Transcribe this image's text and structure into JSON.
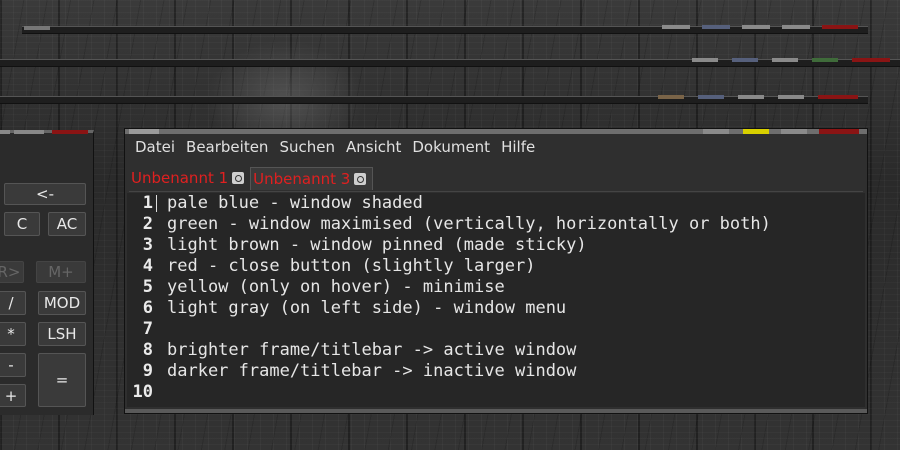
{
  "colors": {
    "pale_blue": "#56607c",
    "green": "#3f6b3a",
    "light_brown": "#7a6448",
    "red": "#8a1414",
    "yellow": "#d8d000",
    "light_gray": "#8a8a8a",
    "tab_text": "#e02020"
  },
  "calculator": {
    "buttons": [
      "<-",
      "C",
      "AC",
      "/",
      "MOD",
      "*",
      "LSH",
      "-",
      "=",
      "+"
    ],
    "dim_buttons": [
      "R>",
      "M+"
    ]
  },
  "editor": {
    "menu": [
      "Datei",
      "Bearbeiten",
      "Suchen",
      "Ansicht",
      "Dokument",
      "Hilfe"
    ],
    "tabs": [
      {
        "label": "Unbenannt 1",
        "icon": "close-icon"
      },
      {
        "label": "Unbenannt 3",
        "icon": "close-icon"
      }
    ],
    "lines": [
      {
        "num": "1",
        "text": "pale blue - window shaded"
      },
      {
        "num": "2",
        "text": "green - window maximised (vertically, horizontally or both)"
      },
      {
        "num": "3",
        "text": "light brown - window pinned (made sticky)"
      },
      {
        "num": "4",
        "text": "red - close button (slightly larger)"
      },
      {
        "num": "5",
        "text": "yellow (only on hover) - minimise"
      },
      {
        "num": "6",
        "text": "light gray (on left side) - window menu"
      },
      {
        "num": "7",
        "text": ""
      },
      {
        "num": "8",
        "text": "brighter frame/titlebar -> active window"
      },
      {
        "num": "9",
        "text": "darker frame/titlebar -> inactive window"
      },
      {
        "num": "10",
        "text": ""
      }
    ]
  }
}
